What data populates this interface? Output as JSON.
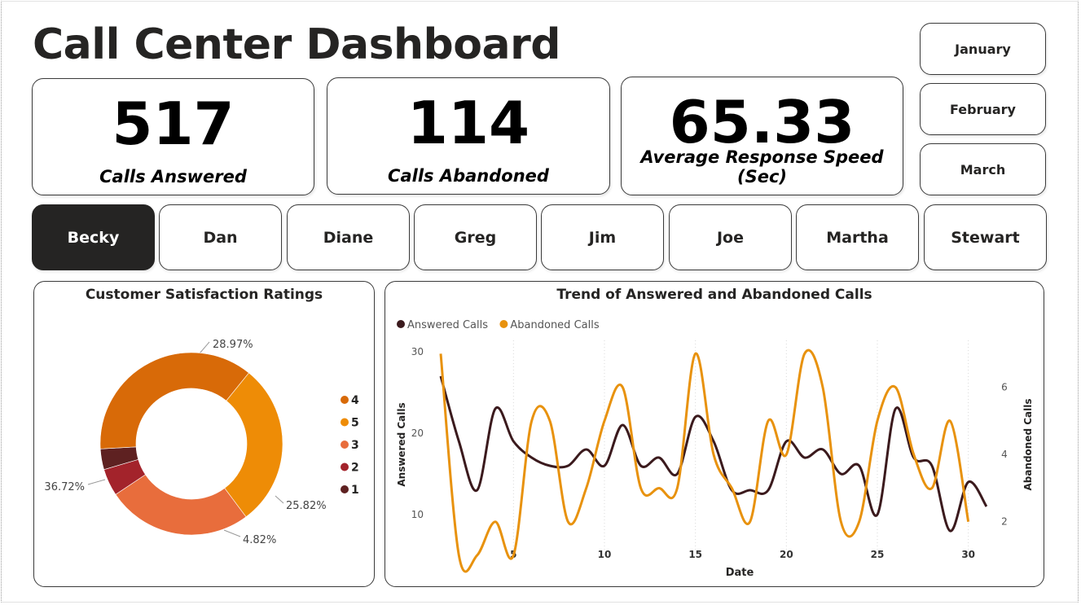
{
  "header": {
    "title": "Call Center Dashboard"
  },
  "kpis": [
    {
      "value": "517",
      "label": "Calls Answered"
    },
    {
      "value": "114",
      "label": "Calls Abandoned"
    },
    {
      "value": "65.33",
      "label": "Average Response Speed (Sec)"
    }
  ],
  "months": [
    "January",
    "February",
    "March"
  ],
  "agents": [
    "Becky",
    "Dan",
    "Diane",
    "Greg",
    "Jim",
    "Joe",
    "Martha",
    "Stewart"
  ],
  "selected_agent": "Becky",
  "colors": {
    "dark": "#252423",
    "answered": "#3b1a1d",
    "abandoned": "#e8920e",
    "rating_4": "#d86a08",
    "rating_5": "#ee8c06",
    "rating_3": "#e86d3c",
    "rating_2": "#a3232b",
    "rating_1": "#5e2121"
  },
  "chart_data": [
    {
      "type": "pie",
      "title": "Customer Satisfaction Ratings",
      "donut": true,
      "legend_position": "right",
      "legend": [
        "4",
        "5",
        "3",
        "2",
        "1"
      ],
      "slices": [
        {
          "label": "5",
          "percent": 28.97,
          "display": "28.97%",
          "color": "#ee8c06"
        },
        {
          "label": "3",
          "percent": 25.82,
          "display": "25.82%",
          "color": "#e86d3c"
        },
        {
          "label": "2",
          "percent": 4.82,
          "display": "4.82%",
          "color": "#a3232b"
        },
        {
          "label": "1",
          "percent": 3.67,
          "display": "",
          "color": "#5e2121"
        },
        {
          "label": "4",
          "percent": 36.72,
          "display": "36.72%",
          "color": "#d86a08"
        }
      ]
    },
    {
      "type": "line",
      "title": "Trend of Answered and Abandoned Calls",
      "xlabel": "Date",
      "ylabel": "Answered Calls",
      "y2label": "Abandoned Calls",
      "xlim": [
        1,
        31
      ],
      "x_ticks": [
        5,
        10,
        15,
        20,
        25,
        30
      ],
      "ylim": [
        5,
        31
      ],
      "y_ticks": [
        10,
        20,
        30
      ],
      "y2lim": [
        1,
        7.3
      ],
      "y2_ticks": [
        2,
        4,
        6
      ],
      "legend_position": "top-left",
      "series": [
        {
          "name": "Answered Calls",
          "axis": "left",
          "color": "#3b1a1d",
          "x": [
            1,
            2,
            3,
            4,
            5,
            6,
            7,
            8,
            9,
            10,
            11,
            12,
            13,
            14,
            15,
            16,
            17,
            18,
            19,
            20,
            21,
            22,
            23,
            24,
            25,
            26,
            27,
            28,
            29,
            30,
            31
          ],
          "values": [
            27,
            19,
            13,
            23,
            19,
            17,
            16,
            16,
            18,
            16,
            21,
            16,
            17,
            15,
            22,
            19,
            13,
            13,
            13,
            19,
            17,
            18,
            15,
            16,
            10,
            23,
            17,
            16,
            8,
            14,
            11
          ]
        },
        {
          "name": "Abandoned Calls",
          "axis": "right",
          "color": "#e8920e",
          "x": [
            1,
            2,
            3,
            4,
            5,
            6,
            7,
            8,
            9,
            10,
            11,
            12,
            13,
            14,
            15,
            16,
            17,
            18,
            19,
            20,
            21,
            22,
            23,
            24,
            25,
            26,
            27,
            28,
            29,
            30
          ],
          "values": [
            7,
            1,
            1,
            2,
            1,
            5,
            5,
            2,
            3,
            5,
            6,
            3,
            3,
            3,
            7,
            4,
            3,
            2,
            5,
            4,
            7,
            6,
            2,
            2,
            5,
            6,
            4,
            3,
            5,
            2
          ]
        }
      ]
    }
  ]
}
